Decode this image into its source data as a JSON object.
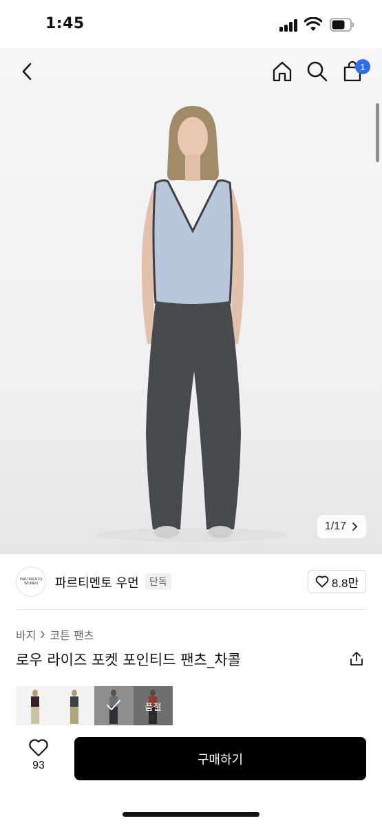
{
  "status_bar": {
    "time": "1:45",
    "icons": [
      "cellular-signal-icon",
      "wifi-icon",
      "battery-icon"
    ]
  },
  "nav": {
    "icons": [
      "back-icon",
      "home-icon",
      "search-icon",
      "shopping-bag-icon"
    ],
    "cart_count": "1",
    "badge_color": "#2f6fe8"
  },
  "gallery": {
    "counter": "1/17"
  },
  "brand": {
    "logo_line1": "PARTIMENTO",
    "logo_line2": "WOMEN",
    "name": "파르티멘토 우먼",
    "badge": "단독",
    "likes": "8.8만"
  },
  "product": {
    "category_main": "바지",
    "category_sub": "코튼 팬츠",
    "title": "로우 라이즈 포켓 포인티드 팬츠_차콜"
  },
  "swatches": [
    {
      "id": "swatch-1",
      "selected": false,
      "soldout": false
    },
    {
      "id": "swatch-2",
      "selected": false,
      "soldout": false
    },
    {
      "id": "swatch-3",
      "selected": true,
      "soldout": false
    },
    {
      "id": "swatch-4",
      "selected": false,
      "soldout": true,
      "label": "품절"
    }
  ],
  "bottom_bar": {
    "like_count": "93",
    "buy_label": "구매하기"
  }
}
